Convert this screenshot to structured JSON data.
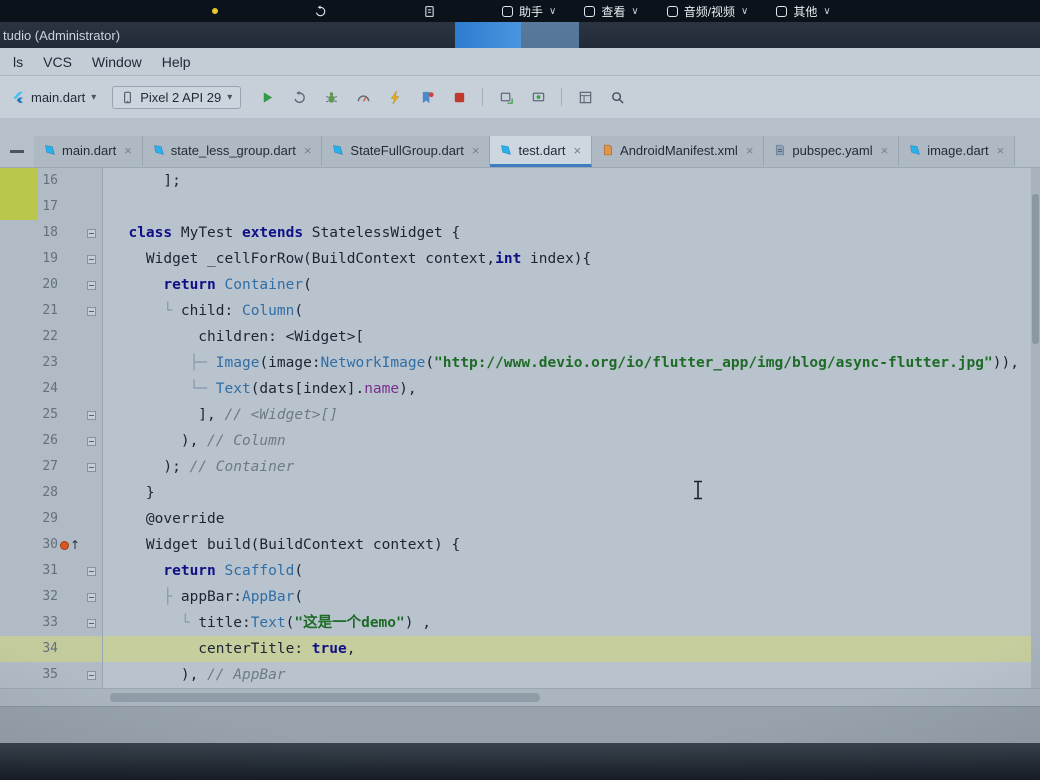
{
  "icons": {
    "chevron_down": "∨",
    "dropdown_caret": "▾",
    "close": "×",
    "up_arrow": "↑"
  },
  "colors": {
    "accent_blue": "#3f7dc0",
    "keyword": "#0f0f86",
    "class_ref": "#2f6ea6",
    "string_green": "#1d6b26",
    "comment_gray": "#6e7a87",
    "caret_line": "#c7ce9e",
    "change_marker": "#b9c84c",
    "run_green": "#349946",
    "stop_red": "#c0392b",
    "hot_reload_yellow": "#e8b019"
  },
  "overlay_bar": {
    "buttons": [
      {
        "name": "assistant-button",
        "label": "助手"
      },
      {
        "name": "view-button",
        "label": "查看"
      },
      {
        "name": "audio-video-button",
        "label": "音频/视频"
      },
      {
        "name": "more-button",
        "label": "其他"
      }
    ]
  },
  "title_bar": {
    "title": "tudio (Administrator)"
  },
  "menu_bar": {
    "items": [
      {
        "name": "menu-tools",
        "label": "ls"
      },
      {
        "name": "menu-vcs",
        "label": "VCS"
      },
      {
        "name": "menu-window",
        "label": "Window"
      },
      {
        "name": "menu-help",
        "label": "Help"
      }
    ]
  },
  "toolbar": {
    "run_config": "main.dart",
    "device": "Pixel 2 API 29",
    "icons": [
      "run-icon",
      "apply-changes-icon",
      "attach-debugger-icon",
      "profiler-icon",
      "hot-reload-icon",
      "hot-restart-icon",
      "stop-icon",
      "sep",
      "screenshot-icon",
      "screen-record-icon",
      "sep",
      "layout-inspector-icon",
      "search-icon"
    ]
  },
  "tabs": [
    {
      "label": "main.dart",
      "icon": "dart-file-icon",
      "active": false
    },
    {
      "label": "state_less_group.dart",
      "icon": "dart-file-icon",
      "active": false
    },
    {
      "label": "StateFullGroup.dart",
      "icon": "dart-file-icon",
      "active": false
    },
    {
      "label": "test.dart",
      "icon": "dart-file-icon",
      "active": true
    },
    {
      "label": "AndroidManifest.xml",
      "icon": "manifest-file-icon",
      "active": false
    },
    {
      "label": "pubspec.yaml",
      "icon": "yaml-file-icon",
      "active": false
    },
    {
      "label": "image.dart",
      "icon": "dart-file-icon",
      "active": false
    }
  ],
  "editor": {
    "lines": [
      {
        "num": 16,
        "changed": true,
        "seg": [
          [
            "      ];",
            "def"
          ]
        ]
      },
      {
        "num": 17,
        "changed": true,
        "seg": []
      },
      {
        "num": 18,
        "fold": true,
        "seg": [
          [
            "  ",
            "def"
          ],
          [
            "class",
            "kw"
          ],
          [
            " MyTest ",
            "def"
          ],
          [
            "extends",
            "kw"
          ],
          [
            " StatelessWidget {",
            "def"
          ]
        ]
      },
      {
        "num": 19,
        "fold": true,
        "seg": [
          [
            "    Widget _cellForRow(BuildContext context,",
            "def"
          ],
          [
            "int",
            "kw"
          ],
          [
            " index){",
            "def"
          ]
        ]
      },
      {
        "num": 20,
        "fold": true,
        "seg": [
          [
            "      ",
            "def"
          ],
          [
            "return",
            "kw"
          ],
          [
            " ",
            "def"
          ],
          [
            "Container",
            "cls"
          ],
          [
            "(",
            "def"
          ]
        ]
      },
      {
        "num": 21,
        "fold": true,
        "seg": [
          [
            "      ",
            "def"
          ],
          [
            "└ ",
            "guide"
          ],
          [
            "child: ",
            "def"
          ],
          [
            "Column",
            "cls"
          ],
          [
            "(",
            "def"
          ]
        ]
      },
      {
        "num": 22,
        "seg": [
          [
            "          children: <Widget>[",
            "def"
          ]
        ]
      },
      {
        "num": 23,
        "seg": [
          [
            "         ",
            "def"
          ],
          [
            "├─ ",
            "guide"
          ],
          [
            "Image",
            "cls"
          ],
          [
            "(image:",
            "def"
          ],
          [
            "NetworkImage",
            "cls"
          ],
          [
            "(",
            "def"
          ],
          [
            "\"http://www.devio.org/io/flutter_app/img/blog/async-flutter.jpg\"",
            "str"
          ],
          [
            ")),",
            "def"
          ]
        ]
      },
      {
        "num": 24,
        "seg": [
          [
            "         ",
            "def"
          ],
          [
            "└─ ",
            "guide"
          ],
          [
            "Text",
            "cls"
          ],
          [
            "(dats[index].",
            "def"
          ],
          [
            "name",
            "fld"
          ],
          [
            "),",
            "def"
          ]
        ]
      },
      {
        "num": 25,
        "fold": true,
        "seg": [
          [
            "          ],",
            "def"
          ],
          [
            " // <Widget>[]",
            "cmt"
          ]
        ]
      },
      {
        "num": 26,
        "fold": true,
        "seg": [
          [
            "        ),",
            "def"
          ],
          [
            " // Column",
            "cmt"
          ]
        ]
      },
      {
        "num": 27,
        "fold": true,
        "seg": [
          [
            "      );",
            "def"
          ],
          [
            " // Container",
            "cmt"
          ]
        ]
      },
      {
        "num": 28,
        "seg": [
          [
            "    }",
            "def"
          ]
        ]
      },
      {
        "num": 29,
        "seg": [
          [
            "    @override",
            "def"
          ]
        ]
      },
      {
        "num": 30,
        "marker": "override",
        "seg": [
          [
            "    Widget build(BuildContext context) {",
            "def"
          ]
        ]
      },
      {
        "num": 31,
        "fold": true,
        "seg": [
          [
            "      ",
            "def"
          ],
          [
            "return",
            "kw"
          ],
          [
            " ",
            "def"
          ],
          [
            "Scaffold",
            "cls"
          ],
          [
            "(",
            "def"
          ]
        ]
      },
      {
        "num": 32,
        "fold": true,
        "seg": [
          [
            "      ",
            "def"
          ],
          [
            "├ ",
            "guide"
          ],
          [
            "appBar:",
            "def"
          ],
          [
            "AppBar",
            "cls"
          ],
          [
            "(",
            "def"
          ]
        ]
      },
      {
        "num": 33,
        "fold": true,
        "seg": [
          [
            "        ",
            "def"
          ],
          [
            "└ ",
            "guide"
          ],
          [
            "title:",
            "def"
          ],
          [
            "Text",
            "cls"
          ],
          [
            "(",
            "def"
          ],
          [
            "\"这是一个demo\"",
            "str"
          ],
          [
            ") ,",
            "def"
          ]
        ]
      },
      {
        "num": 34,
        "caret": true,
        "seg": [
          [
            "          centerTitle: ",
            "def"
          ],
          [
            "true",
            "kw"
          ],
          [
            ",",
            "def"
          ]
        ]
      },
      {
        "num": 35,
        "fold": true,
        "seg": [
          [
            "        ),",
            "def"
          ],
          [
            " // AppBar",
            "cmt"
          ]
        ]
      }
    ]
  }
}
